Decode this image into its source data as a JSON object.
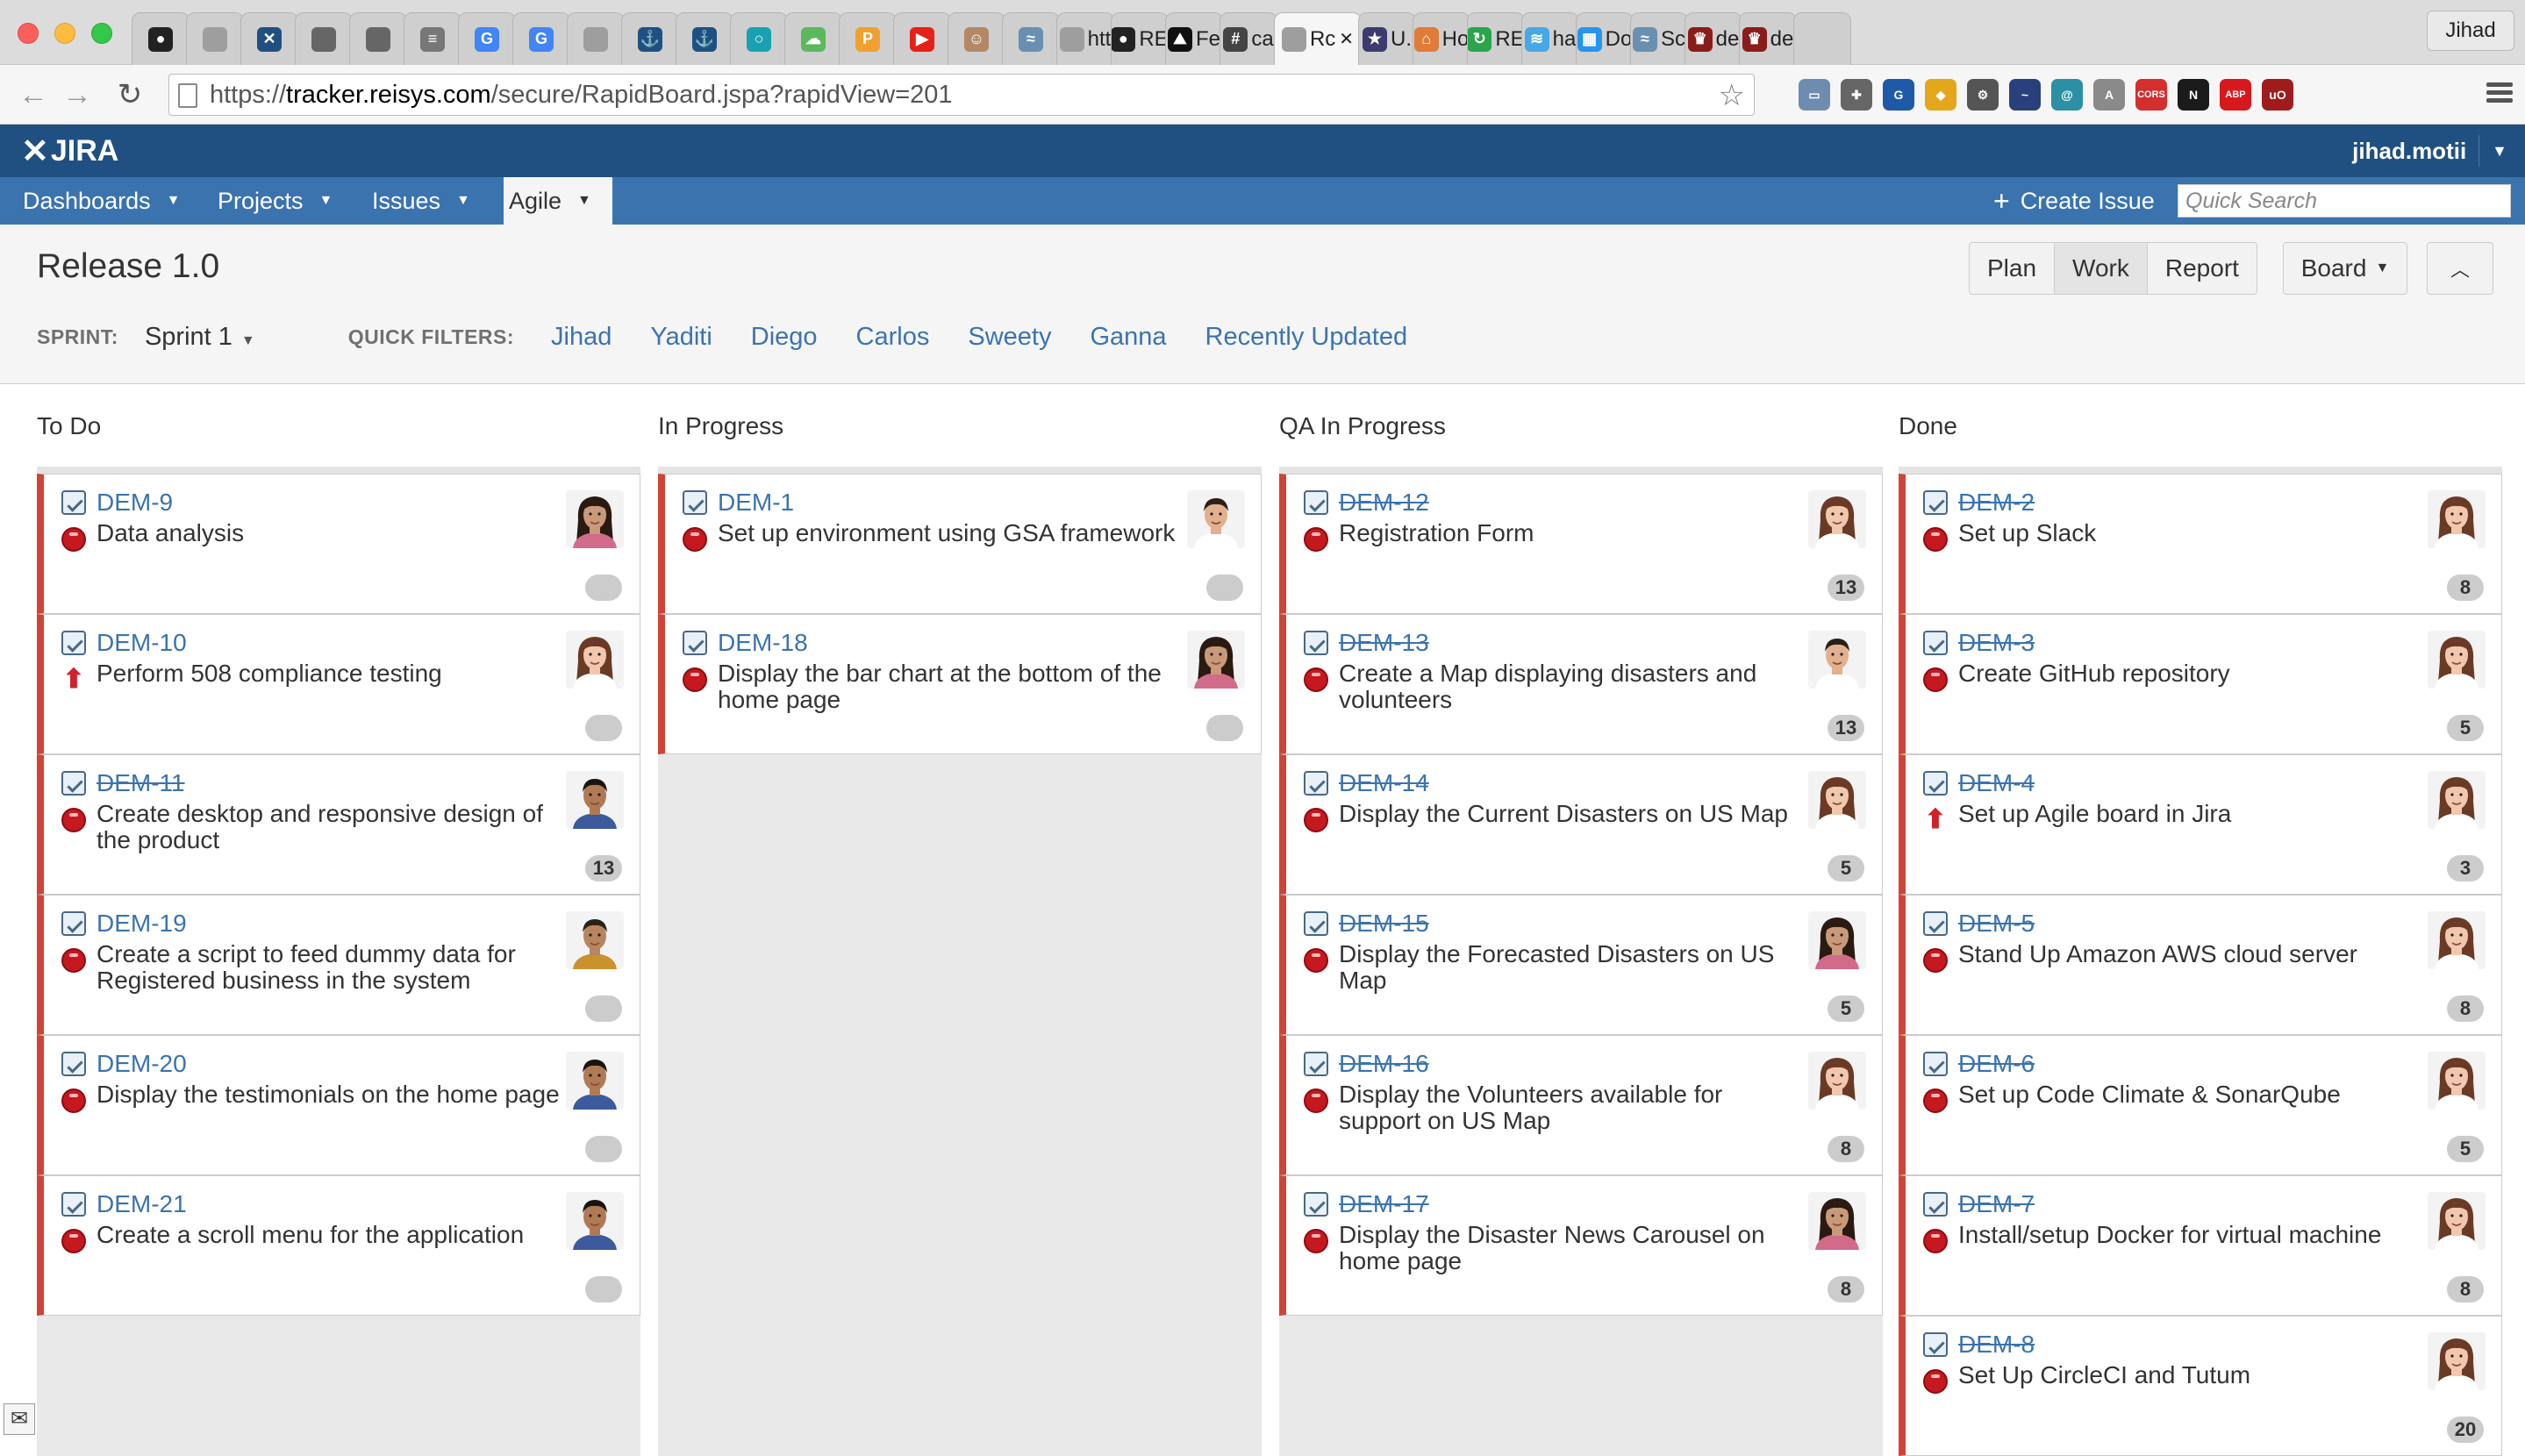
{
  "browser": {
    "tabs": [
      {
        "icon": "github-icon",
        "label": "",
        "color": "#222222",
        "glyph": "●"
      },
      {
        "icon": "blank-page-icon",
        "label": "",
        "color": "#9e9e9e",
        "glyph": ""
      },
      {
        "icon": "confluence-icon",
        "label": "",
        "color": "#205081",
        "glyph": "✕"
      },
      {
        "icon": "apple-icon",
        "label": "",
        "color": "#666666",
        "glyph": ""
      },
      {
        "icon": "apple-icon",
        "label": "",
        "color": "#666666",
        "glyph": ""
      },
      {
        "icon": "stack-icon",
        "label": "",
        "color": "#777777",
        "glyph": "≡"
      },
      {
        "icon": "google-icon",
        "label": "",
        "color": "#4285f4",
        "glyph": "G"
      },
      {
        "icon": "google-icon",
        "label": "",
        "color": "#4285f4",
        "glyph": "G"
      },
      {
        "icon": "blank-page-icon",
        "label": "",
        "color": "#9e9e9e",
        "glyph": ""
      },
      {
        "icon": "jenkins-icon",
        "label": "",
        "color": "#205081",
        "glyph": "⚓"
      },
      {
        "icon": "jenkins-icon",
        "label": "",
        "color": "#205081",
        "glyph": "⚓"
      },
      {
        "icon": "circle-icon",
        "label": "",
        "color": "#1aa1b1",
        "glyph": "○"
      },
      {
        "icon": "cloud-icon",
        "label": "",
        "color": "#5cb85c",
        "glyph": "☁"
      },
      {
        "icon": "p-icon",
        "label": "",
        "color": "#f0a030",
        "glyph": "P"
      },
      {
        "icon": "youtube-icon",
        "label": "",
        "color": "#e62117",
        "glyph": "▶"
      },
      {
        "icon": "avatar-icon",
        "label": "",
        "color": "#b28866",
        "glyph": "☺"
      },
      {
        "icon": "wifi-icon",
        "label": "",
        "color": "#6a8fb0",
        "glyph": "≈"
      },
      {
        "icon": "blank-page-icon",
        "label": "htt",
        "color": "#9e9e9e",
        "glyph": ""
      },
      {
        "icon": "github-icon",
        "label": "RE",
        "color": "#222222",
        "glyph": "●"
      },
      {
        "icon": "chart-icon",
        "label": "Fe",
        "color": "#111111",
        "glyph": "⛰"
      },
      {
        "icon": "slack-icon",
        "label": "ca",
        "color": "#444444",
        "glyph": "#"
      },
      {
        "icon": "page-icon",
        "label": "Rc",
        "color": "#9e9e9e",
        "glyph": "",
        "active": true
      },
      {
        "icon": "us-flag-icon",
        "label": "U.",
        "color": "#3c3b6e",
        "glyph": "★"
      },
      {
        "icon": "hat-icon",
        "label": "Ho",
        "color": "#e07b39",
        "glyph": "⌂"
      },
      {
        "icon": "refresh-icon",
        "label": "RE",
        "color": "#2aa54b",
        "glyph": "↻"
      },
      {
        "icon": "ha-icon",
        "label": "ha",
        "color": "#48a7e5",
        "glyph": "≋"
      },
      {
        "icon": "docker-icon",
        "label": "Do",
        "color": "#2496ed",
        "glyph": "▦"
      },
      {
        "icon": "wifi-icon",
        "label": "Sc",
        "color": "#6a8fb0",
        "glyph": "≈"
      },
      {
        "icon": "spy-icon",
        "label": "de",
        "color": "#8b1c1c",
        "glyph": "♛"
      },
      {
        "icon": "spy-icon",
        "label": "de",
        "color": "#8b1c1c",
        "glyph": "♛"
      },
      {
        "icon": "blank-tab-icon",
        "label": "",
        "color": "#cfcfcf",
        "glyph": ""
      }
    ],
    "profile_name": "Jihad",
    "url_prefix": "https://",
    "url_host": "tracker.reisys.com",
    "url_path": "/secure/RapidBoard.jspa?rapidView=201",
    "extensions": [
      {
        "name": "screen-icon",
        "color": "#6e8cb0",
        "glyph": "▭"
      },
      {
        "name": "wrench-icon",
        "color": "#666666",
        "glyph": "✚"
      },
      {
        "name": "ghostery-icon",
        "color": "#1e5aa8",
        "glyph": "G"
      },
      {
        "name": "lemon-icon",
        "color": "#e4a61b",
        "glyph": "◆"
      },
      {
        "name": "settings-icon",
        "color": "#555555",
        "glyph": "⚙"
      },
      {
        "name": "wave-icon",
        "color": "#29407c",
        "glyph": "~"
      },
      {
        "name": "swirl-icon",
        "color": "#2d8fa3",
        "glyph": "@"
      },
      {
        "name": "angular-icon",
        "color": "#8a8a8a",
        "glyph": "A"
      },
      {
        "name": "cors-icon",
        "color": "#d32f2f",
        "glyph": "CORS"
      },
      {
        "name": "n-icon",
        "color": "#1b1b1b",
        "glyph": "N"
      },
      {
        "name": "adblock-icon",
        "color": "#d7191f",
        "glyph": "ABP"
      },
      {
        "name": "ublock-icon",
        "color": "#a01b1b",
        "glyph": "uO"
      }
    ]
  },
  "jira": {
    "logo": "JIRA",
    "user": "jihad.motii",
    "nav": {
      "dashboards": "Dashboards",
      "projects": "Projects",
      "issues": "Issues",
      "agile": "Agile",
      "create_issue": "Create Issue",
      "search_placeholder": "Quick Search"
    }
  },
  "board": {
    "title": "Release 1.0",
    "sprint_label": "SPRINT:",
    "sprint_value": "Sprint 1",
    "quick_filters_label": "QUICK FILTERS:",
    "quick_filters": [
      "Jihad",
      "Yaditi",
      "Diego",
      "Carlos",
      "Sweety",
      "Ganna",
      "Recently Updated"
    ],
    "modes": [
      "Plan",
      "Work",
      "Report"
    ],
    "active_mode": "Work",
    "board_menu": "Board",
    "columns": [
      {
        "title": "To Do",
        "cards": [
          {
            "key": "DEM-9",
            "summary": "Data analysis",
            "priority": "blocker",
            "done": false,
            "estimate": "",
            "assignee": "f1"
          },
          {
            "key": "DEM-10",
            "summary": "Perform 508 compliance testing",
            "priority": "major",
            "done": false,
            "estimate": "",
            "assignee": "f2"
          },
          {
            "key": "DEM-11",
            "summary": "Create desktop and responsive design of the product",
            "priority": "blocker",
            "done": true,
            "estimate": "13",
            "assignee": "m1"
          },
          {
            "key": "DEM-19",
            "summary": "Create a script to feed dummy data for Registered business in the system",
            "priority": "blocker",
            "done": false,
            "estimate": "",
            "assignee": "m3"
          },
          {
            "key": "DEM-20",
            "summary": "Display the testimonials on the home page",
            "priority": "blocker",
            "done": false,
            "estimate": "",
            "assignee": "m1"
          },
          {
            "key": "DEM-21",
            "summary": "Create a scroll menu for the application",
            "priority": "blocker",
            "done": false,
            "estimate": "",
            "assignee": "m1"
          }
        ]
      },
      {
        "title": "In Progress",
        "cards": [
          {
            "key": "DEM-1",
            "summary": "Set up environment using GSA framework",
            "priority": "blocker",
            "done": false,
            "estimate": "",
            "assignee": "m2"
          },
          {
            "key": "DEM-18",
            "summary": "Display the bar chart at the bottom of the home page",
            "priority": "blocker",
            "done": false,
            "estimate": "",
            "assignee": "f1"
          }
        ]
      },
      {
        "title": "QA In Progress",
        "cards": [
          {
            "key": "DEM-12",
            "summary": "Registration Form",
            "priority": "blocker",
            "done": true,
            "estimate": "13",
            "assignee": "f2"
          },
          {
            "key": "DEM-13",
            "summary": "Create a Map displaying disasters and volunteers",
            "priority": "blocker",
            "done": true,
            "estimate": "13",
            "assignee": "m2"
          },
          {
            "key": "DEM-14",
            "summary": "Display the Current Disasters on US Map",
            "priority": "blocker",
            "done": true,
            "estimate": "5",
            "assignee": "f2"
          },
          {
            "key": "DEM-15",
            "summary": "Display the Forecasted Disasters on US Map",
            "priority": "blocker",
            "done": true,
            "estimate": "5",
            "assignee": "f1"
          },
          {
            "key": "DEM-16",
            "summary": "Display the Volunteers available for support on US Map",
            "priority": "blocker",
            "done": true,
            "estimate": "8",
            "assignee": "f2"
          },
          {
            "key": "DEM-17",
            "summary": "Display the Disaster News Carousel on home page",
            "priority": "blocker",
            "done": true,
            "estimate": "8",
            "assignee": "f1"
          }
        ]
      },
      {
        "title": "Done",
        "cards": [
          {
            "key": "DEM-2",
            "summary": "Set up Slack",
            "priority": "blocker",
            "done": true,
            "estimate": "8",
            "assignee": "f2"
          },
          {
            "key": "DEM-3",
            "summary": "Create GitHub repository",
            "priority": "blocker",
            "done": true,
            "estimate": "5",
            "assignee": "f2"
          },
          {
            "key": "DEM-4",
            "summary": "Set up Agile board in Jira",
            "priority": "major",
            "done": true,
            "estimate": "3",
            "assignee": "f2"
          },
          {
            "key": "DEM-5",
            "summary": "Stand Up Amazon AWS cloud server",
            "priority": "blocker",
            "done": true,
            "estimate": "8",
            "assignee": "f2"
          },
          {
            "key": "DEM-6",
            "summary": "Set up Code Climate & SonarQube",
            "priority": "blocker",
            "done": true,
            "estimate": "5",
            "assignee": "f2"
          },
          {
            "key": "DEM-7",
            "summary": "Install/setup Docker for virtual machine",
            "priority": "blocker",
            "done": true,
            "estimate": "8",
            "assignee": "f2"
          },
          {
            "key": "DEM-8",
            "summary": "Set Up CircleCI and Tutum",
            "priority": "blocker",
            "done": true,
            "estimate": "20",
            "assignee": "f2"
          }
        ]
      }
    ]
  },
  "colors": {
    "jira_header": "#205081",
    "jira_nav": "#3b73af",
    "link": "#3b73af",
    "card_border": "#d04437",
    "blocker": "#c5181f"
  },
  "avatars": {
    "f1": {
      "skin": "#c89a7a",
      "hair": "#2a1a12",
      "shirt": "#d26a8a"
    },
    "f2": {
      "skin": "#f1c7ad",
      "hair": "#6a3a26",
      "shirt": "#ffffff"
    },
    "m1": {
      "skin": "#b07a55",
      "hair": "#1a1410",
      "shirt": "#3c5a9c"
    },
    "m2": {
      "skin": "#e0b08f",
      "hair": "#2b2018",
      "shirt": "#ffffff"
    },
    "m3": {
      "skin": "#b58660",
      "hair": "#2a2018",
      "shirt": "#c9922c"
    }
  }
}
